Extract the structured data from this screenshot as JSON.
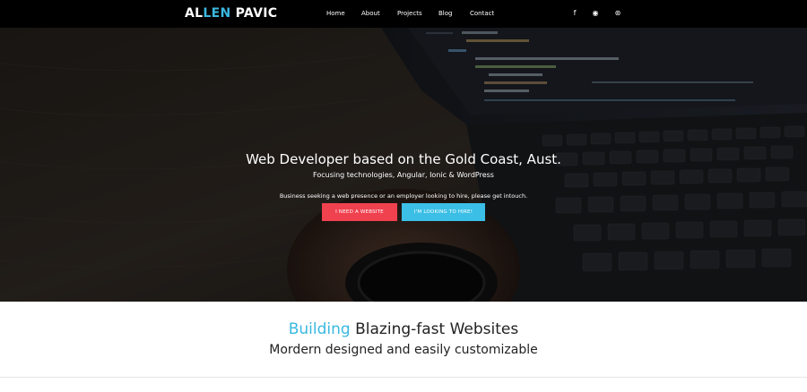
{
  "brand": {
    "part1": "AL",
    "part2": "LEN",
    "part3": " PAVIC"
  },
  "nav": {
    "items": [
      {
        "label": "Home"
      },
      {
        "label": "About"
      },
      {
        "label": "Projects"
      },
      {
        "label": "Blog"
      },
      {
        "label": "Contact"
      }
    ],
    "social": [
      {
        "icon": "facebook-icon",
        "glyph": "f"
      },
      {
        "icon": "github-icon",
        "glyph": "◉"
      },
      {
        "icon": "stackexchange-icon",
        "glyph": "⊛"
      }
    ]
  },
  "hero": {
    "title": "Web Developer based on the Gold Coast, Aust.",
    "subtitle": "Focusing technologies, Angular, Ionic & WordPress",
    "note": "Business seeking a web presence or an employer looking to hire, please get intouch.",
    "btn_website": "I need a website",
    "btn_hire": "I'm looking to hire!"
  },
  "section": {
    "title_accent": "Building",
    "title_rest": " Blazing-fast Websites",
    "subtitle": "Mordern designed and easily customizable"
  },
  "colors": {
    "accent": "#3ab8e0",
    "btn_website": "#f0414f",
    "btn_hire": "#3bbfe6",
    "nav_bg": "#000000"
  }
}
